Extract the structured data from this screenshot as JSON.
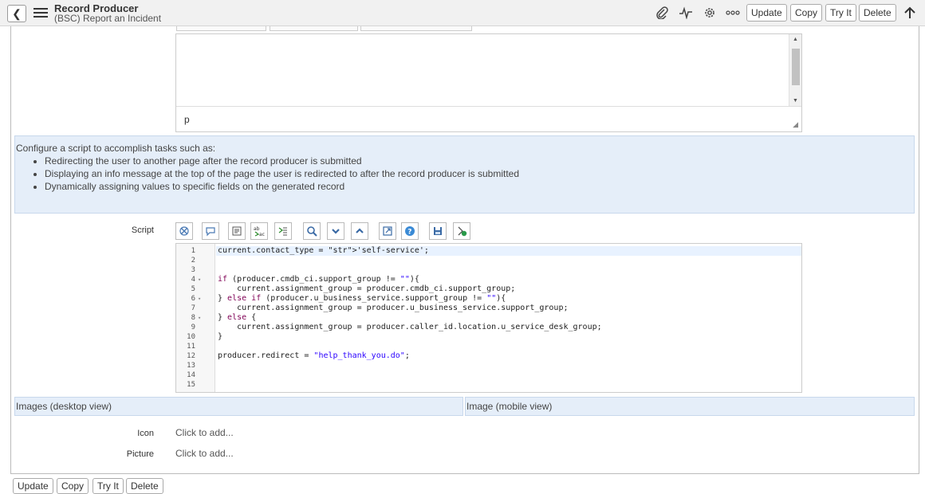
{
  "header": {
    "title": "Record Producer",
    "subtitle": "(BSC) Report an Incident",
    "buttons": {
      "update": "Update",
      "copy": "Copy",
      "try_it": "Try It",
      "delete": "Delete"
    }
  },
  "html_editor": {
    "status_path": "p"
  },
  "info": {
    "intro": "Configure a script to accomplish tasks such as:",
    "items": [
      "Redirecting the user to another page after the record producer is submitted",
      "Displaying an info message at the top of the page the user is redirected to after the record producer is submitted",
      "Dynamically assigning values to specific fields on the generated record"
    ]
  },
  "script": {
    "label": "Script",
    "line_numbers": [
      "1",
      "2",
      "3",
      "4",
      "5",
      "6",
      "7",
      "8",
      "9",
      "10",
      "11",
      "12",
      "13",
      "14",
      "15"
    ],
    "lines": [
      "current.contact_type = 'self-service';",
      "",
      "",
      "if (producer.cmdb_ci.support_group != \"\"){",
      "    current.assignment_group = producer.cmdb_ci.support_group;",
      "} else if (producer.u_business_service.support_group != \"\"){",
      "    current.assignment_group = producer.u_business_service.support_group;",
      "} else {",
      "    current.assignment_group = producer.caller_id.location.u_service_desk_group;",
      "}",
      "",
      "producer.redirect = \"help_thank_you.do\";",
      "",
      "",
      ""
    ]
  },
  "sections": {
    "desktop": "Images (desktop view)",
    "mobile": "Image (mobile view)"
  },
  "fields": {
    "icon_label": "Icon",
    "icon_value": "Click to add...",
    "picture_label": "Picture",
    "picture_value": "Click to add..."
  },
  "footer_buttons": {
    "update": "Update",
    "copy": "Copy",
    "try_it": "Try It",
    "delete": "Delete"
  }
}
